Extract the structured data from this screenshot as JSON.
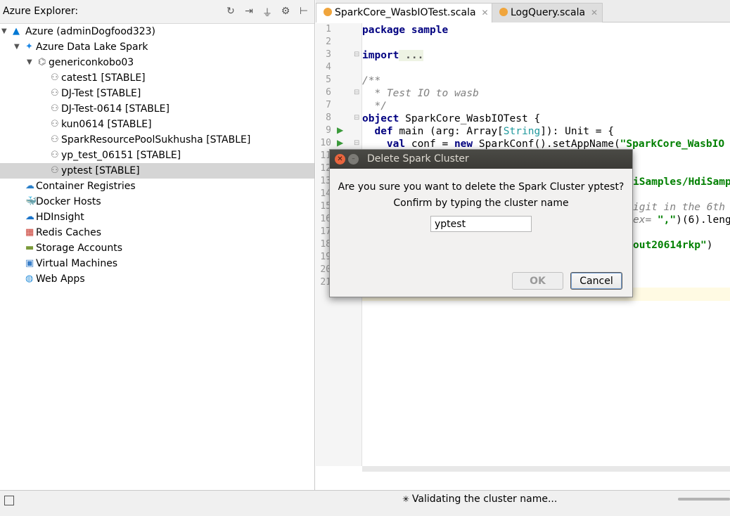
{
  "explorer": {
    "title": "Azure Explorer:",
    "tree": [
      {
        "label": "Azure (adminDogfood323)",
        "icon": "azure-logo-icon",
        "level": 0,
        "expanded": true
      },
      {
        "label": "Azure Data Lake Spark",
        "icon": "spark-star-icon",
        "level": 1,
        "expanded": true
      },
      {
        "label": "genericonkobo03",
        "icon": "spark-pool-icon",
        "level": 2,
        "expanded": true
      },
      {
        "label": "catest1 [STABLE]",
        "icon": "cluster-icon",
        "level": 3
      },
      {
        "label": "DJ-Test [STABLE]",
        "icon": "cluster-icon",
        "level": 3
      },
      {
        "label": "DJ-Test-0614 [STABLE]",
        "icon": "cluster-icon",
        "level": 3
      },
      {
        "label": "kun0614 [STABLE]",
        "icon": "cluster-icon",
        "level": 3
      },
      {
        "label": "SparkResourcePoolSukhusha [STABLE]",
        "icon": "cluster-icon",
        "level": 3
      },
      {
        "label": "yp_test_06151 [STABLE]",
        "icon": "cluster-icon",
        "level": 3
      },
      {
        "label": "yptest [STABLE]",
        "icon": "cluster-icon",
        "level": 3,
        "selected": true
      },
      {
        "label": "Container Registries",
        "icon": "container-registry-icon",
        "level": 1
      },
      {
        "label": "Docker Hosts",
        "icon": "docker-icon",
        "level": 1
      },
      {
        "label": "HDInsight",
        "icon": "hdinsight-icon",
        "level": 1
      },
      {
        "label": "Redis Caches",
        "icon": "redis-icon",
        "level": 1
      },
      {
        "label": "Storage Accounts",
        "icon": "storage-icon",
        "level": 1
      },
      {
        "label": "Virtual Machines",
        "icon": "vm-icon",
        "level": 1
      },
      {
        "label": "Web Apps",
        "icon": "web-apps-icon",
        "level": 1
      }
    ]
  },
  "tabs": [
    {
      "label": "SparkCore_WasbIOTest.scala",
      "active": true
    },
    {
      "label": "LogQuery.scala",
      "active": false
    }
  ],
  "editor": {
    "line_numbers": [
      "1",
      "2",
      "3",
      "4",
      "5",
      "6",
      "7",
      "8",
      "9",
      "10",
      "11",
      "12",
      "13",
      "14",
      "15",
      "16",
      "17",
      "18",
      "19",
      "20",
      "21"
    ],
    "code": {
      "l1": "package sample",
      "l3a": "import",
      "l3b": " ...",
      "l6": "/**",
      "l7": "  * Test IO to wasb",
      "l8": "  */",
      "l9a": "object",
      "l9b": " SparkCore_WasbIOTest {",
      "l10a": "  def",
      "l10b": " main (arg: Array[",
      "l10c": "String",
      "l10d": "]): Unit = {",
      "l11a": "    val",
      "l11b": " conf = ",
      "l11c": "new",
      "l11d": " SparkConf().setAppName(",
      "l11e": "\"SparkCore_WasbIO",
      "l14": "iSamples/HdiSamp",
      "l16": "igit in the 6th",
      "l17a": "ex= ",
      "l17b": "\",\"",
      "l17c": ")(6).lengt",
      "l19a": "out20614rkp\"",
      "l19b": ")"
    }
  },
  "dialog": {
    "title": "Delete Spark Cluster",
    "message1": "Are you sure you want to delete the Spark Cluster yptest?",
    "message2": "Confirm by typing the cluster name",
    "input_value": "yptest",
    "ok_label": "OK",
    "cancel_label": "Cancel"
  },
  "status": {
    "text": "Validating the cluster name..."
  }
}
